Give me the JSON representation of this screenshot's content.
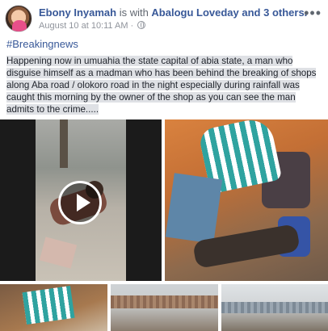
{
  "post": {
    "author": "Ebony Inyamah",
    "connector": " is with ",
    "tagged": "Abalogu Loveday and 3 others.",
    "timestamp": "August 10 at 10:11 AM",
    "separator": " · ",
    "more_label": "•••",
    "hashtag": "#Breakingnews",
    "text": "Happening now in umuahia the state capital of abia state, a man who disguise himself as a madman who has been behind the breaking of shops along Aba road / olokoro road in the night especially during rainfall was caught this morning by the owner of the shop as you can see the man admits to the crime....."
  },
  "icons": {
    "privacy": "globe-icon",
    "menu": "more-options-icon",
    "play": "play-icon"
  },
  "colors": {
    "link": "#385898",
    "meta": "#90949c",
    "highlight": "#dfe1e5"
  }
}
